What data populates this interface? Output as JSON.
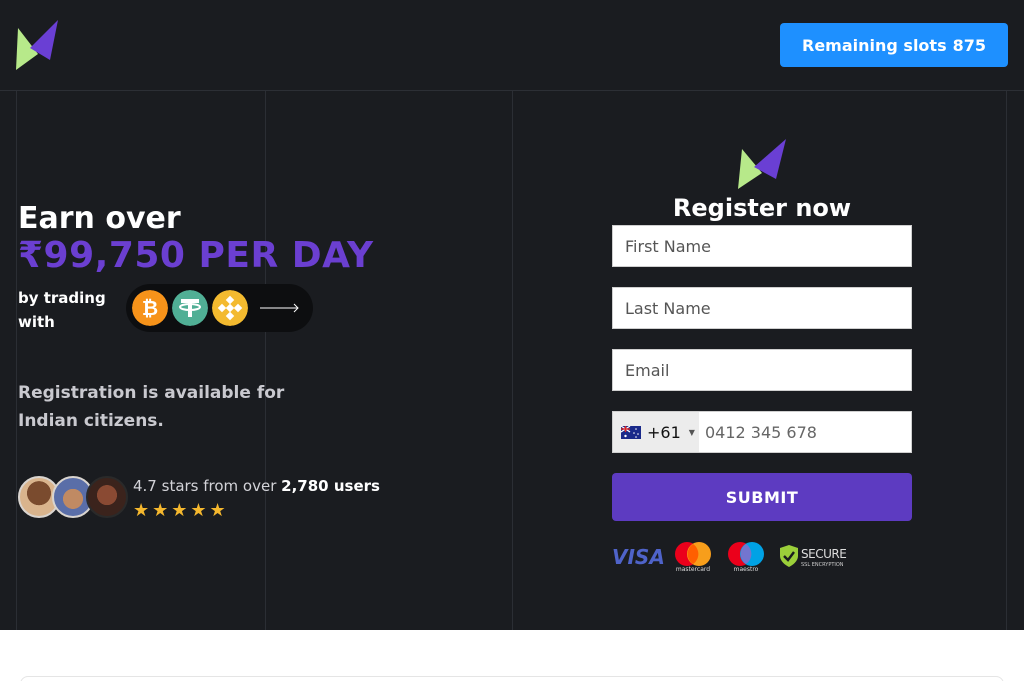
{
  "header": {
    "slots_label": "Remaining slots",
    "slots_count": "875"
  },
  "hero": {
    "earn_line": "Earn over",
    "amount_line": "₹99,750 PER DAY",
    "by_trading": "by trading with",
    "coins": [
      "bitcoin-icon",
      "tether-icon",
      "binance-icon"
    ],
    "registration_note": "Registration is available for Indian citizens.",
    "rating": {
      "prefix": "4.7 stars from over",
      "users": "2,780 users",
      "stars": "★★★★★"
    },
    "accent_color": "#6b3fd1"
  },
  "form": {
    "title": "Register now",
    "first_name_placeholder": "First Name",
    "last_name_placeholder": "Last Name",
    "email_placeholder": "Email",
    "country_code": "+61",
    "phone_placeholder": "0412 345 678",
    "submit_label": "SUBMIT",
    "submit_color": "#5d3bc1"
  },
  "payments": {
    "visa": "VISA",
    "mastercard": "mastercard",
    "maestro": "maestro",
    "secure_title": "SECURE",
    "secure_sub": "SSL ENCRYPTION"
  }
}
